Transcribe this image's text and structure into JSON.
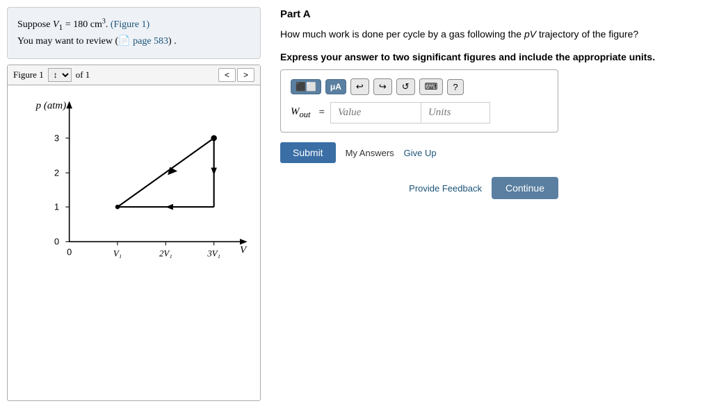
{
  "left": {
    "info_line1": "Suppose ",
    "info_v1": "V",
    "info_v1_sub": "1",
    "info_eq": " = 180 cm",
    "info_sup": "3",
    "info_period": ".",
    "info_figure_link": "(Figure 1)",
    "info_line2": "You may want to review (",
    "info_page_link": "page 583",
    "info_line2_end": ") .",
    "figure_label": "Figure 1",
    "figure_of": "of 1",
    "nav_prev": "<",
    "nav_next": ">"
  },
  "right": {
    "part_label": "Part A",
    "question": "How much work is done per cycle by a gas following the pV trajectory of the figure?",
    "express_text": "Express your answer to two significant figures and include the appropriate units.",
    "w_label": "W",
    "w_sub": "out",
    "equals": "=",
    "value_placeholder": "Value",
    "units_placeholder": "Units",
    "toolbar": {
      "matrix_icon": "⬜",
      "mu_icon": "μA",
      "undo_icon": "↩",
      "redo_icon": "↪",
      "refresh_icon": "↺",
      "keyboard_icon": "⌨",
      "help_icon": "?"
    },
    "submit_label": "Submit",
    "my_answers_label": "My Answers",
    "give_up_label": "Give Up",
    "feedback_label": "Provide Feedback",
    "continue_label": "Continue"
  },
  "graph": {
    "x_label": "V",
    "y_label": "p (atm)",
    "x_ticks": [
      "0",
      "V₁",
      "2V₁",
      "3V₁"
    ],
    "y_ticks": [
      "0",
      "1",
      "2",
      "3"
    ]
  }
}
